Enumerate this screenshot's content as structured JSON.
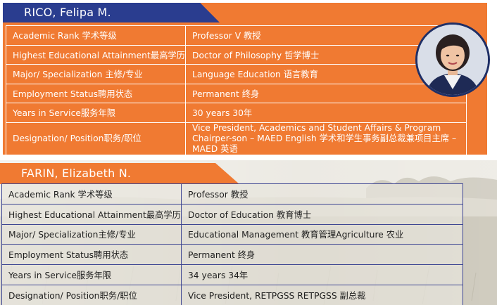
{
  "profiles": [
    {
      "name": "RICO, Felipa M.",
      "rows": [
        {
          "label": "Academic Rank 学术等级",
          "value": "Professor V  教授"
        },
        {
          "label": "Highest Educational Attainment最高学历",
          "value": "Doctor of Philosophy 哲学博士"
        },
        {
          "label": "Major/ Specialization 主修/专业",
          "value": "Language Education  语言教育"
        },
        {
          "label": "Employment Status聘用状态",
          "value": "Permanent    终身"
        },
        {
          "label": "Years in Service服务年限",
          "value": "30 years    30年"
        },
        {
          "label": "Designation/ Position职务/职位",
          "value": "Vice President, Academics and Student Affairs & Program Chairper-son – MAED English 学术和学生事务副总裁兼项目主席 – MAED 英语"
        }
      ]
    },
    {
      "name": "FARIN, Elizabeth N.",
      "rows": [
        {
          "label": "Academic Rank 学术等级",
          "value": "Professor    教授"
        },
        {
          "label": "Highest Educational Attainment最高学历",
          "value": "Doctor of Education 教育博士"
        },
        {
          "label": "Major/ Specialization主修/专业",
          "value": "Educational Management  教育管理Agriculture    农业"
        },
        {
          "label": "Employment Status聘用状态",
          "value": "Permanent    终身"
        },
        {
          "label": "Years in Service服务年限",
          "value": "34 years   34年"
        },
        {
          "label": "Designation/ Position职务/职位",
          "value": "Vice President, RETPGSS RETPGSS 副总裁"
        }
      ]
    }
  ],
  "colors": {
    "orange": "#f07a32",
    "navy": "#2a3d8f",
    "border": "#3d4592"
  },
  "icons": {
    "portrait": "person-photo-icon"
  }
}
